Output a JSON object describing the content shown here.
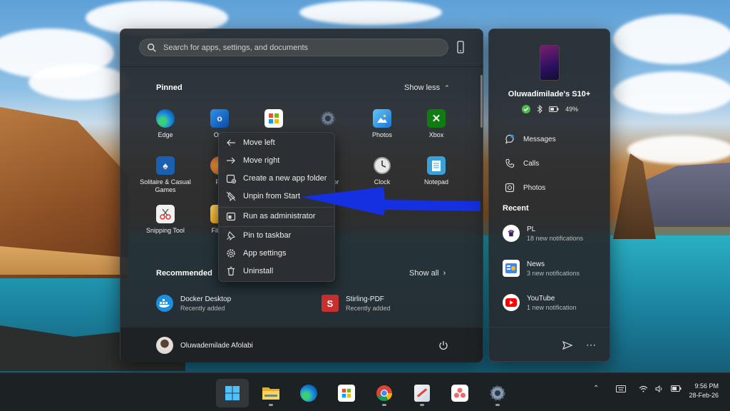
{
  "search": {
    "placeholder": "Search for apps, settings, and documents"
  },
  "pinned": {
    "title": "Pinned",
    "toggle_label": "Show less",
    "apps": [
      {
        "label": "Edge",
        "icon": "edge-icon"
      },
      {
        "label": "Outl",
        "icon": "outlook-icon"
      },
      {
        "label": "",
        "icon": "store-icon"
      },
      {
        "label": "",
        "icon": "settings-icon"
      },
      {
        "label": "Photos",
        "icon": "photos-icon"
      },
      {
        "label": "Xbox",
        "icon": "xbox-icon"
      },
      {
        "label": "Solitaire & Casual Games",
        "icon": "solitaire-icon"
      },
      {
        "label": "Pa",
        "icon": "paint-icon"
      },
      {
        "label": "tor",
        "icon": "calculator-icon"
      },
      {
        "label": "Clock",
        "icon": "clock-icon"
      },
      {
        "label": "Notepad",
        "icon": "notepad-icon"
      },
      {
        "label": "Snipping Tool",
        "icon": "snipping-tool-icon"
      },
      {
        "label": "File E",
        "icon": "file-explorer-icon"
      }
    ]
  },
  "recommended": {
    "title": "Recommended",
    "more_label": "Show all",
    "items": [
      {
        "name": "Docker Desktop",
        "sub": "Recently added",
        "icon": "docker-icon"
      },
      {
        "name": "Stirling-PDF",
        "sub": "Recently added",
        "icon": "stirling-pdf-icon"
      }
    ]
  },
  "user": {
    "name": "Oluwademilade Afolabi"
  },
  "context_menu": {
    "items": [
      {
        "label": "Move left",
        "icon": "arrow-left-icon"
      },
      {
        "label": "Move right",
        "icon": "arrow-right-icon"
      },
      {
        "label": "Create a new app folder",
        "icon": "new-folder-icon"
      },
      {
        "label": "Unpin from Start",
        "icon": "unpin-icon"
      },
      {
        "label": "Run as administrator",
        "icon": "shield-window-icon"
      },
      {
        "label": "Pin to taskbar",
        "icon": "pin-icon"
      },
      {
        "label": "App settings",
        "icon": "gear-icon"
      },
      {
        "label": "Uninstall",
        "icon": "trash-icon"
      }
    ]
  },
  "phone": {
    "device_name": "Oluwadimilade's S10+",
    "battery": "49%",
    "actions": [
      {
        "label": "Messages",
        "icon": "messages-icon"
      },
      {
        "label": "Calls",
        "icon": "phone-call-icon"
      },
      {
        "label": "Photos",
        "icon": "photos-outline-icon"
      }
    ],
    "recent_title": "Recent",
    "notifications": [
      {
        "app": "PL",
        "count": "18 new notifications",
        "icon": "premier-league-icon"
      },
      {
        "app": "News",
        "count": "3 new notifications",
        "icon": "google-news-icon"
      },
      {
        "app": "YouTube",
        "count": "1 new notification",
        "icon": "youtube-icon"
      }
    ]
  },
  "taskbar": {
    "apps": [
      "windows-start-icon",
      "file-explorer-icon",
      "edge-icon",
      "store-icon",
      "chrome-icon",
      "snipping-tool-icon",
      "asana-icon",
      "settings-icon"
    ],
    "time": "9:56 PM",
    "date": "28-Feb-26"
  },
  "colors": {
    "annotation_arrow": "#1430e0",
    "accent": "#0078d4"
  }
}
